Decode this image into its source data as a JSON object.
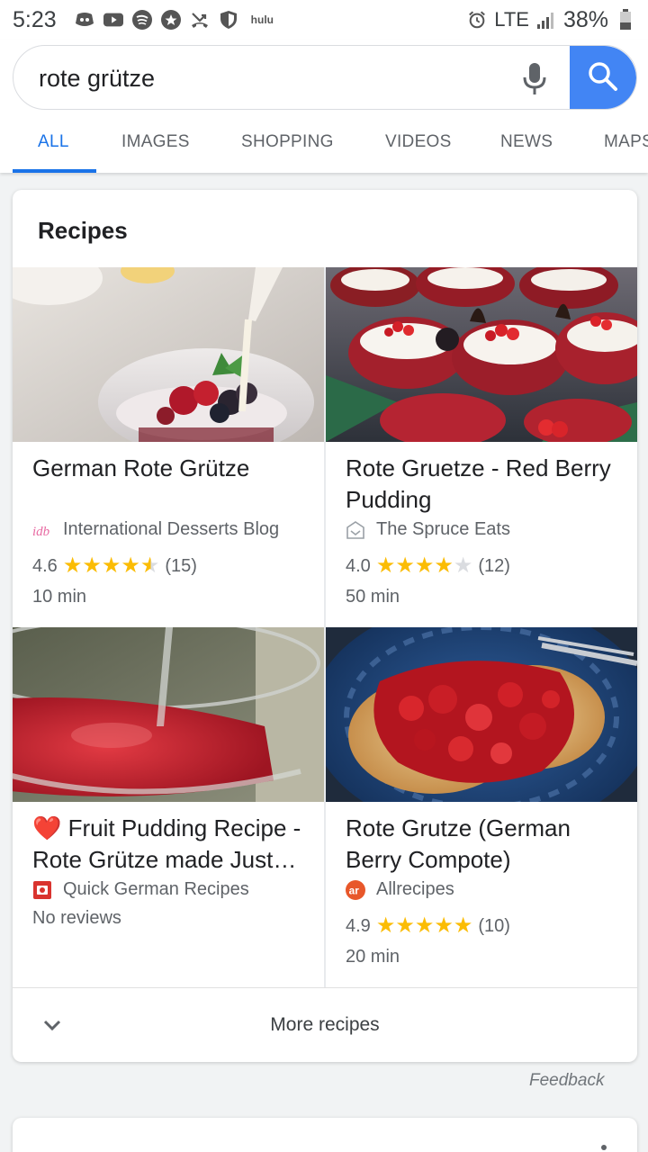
{
  "status": {
    "time": "5:23",
    "hulu": "hulu",
    "network": "LTE",
    "battery": "38%",
    "icons": [
      "discord-icon",
      "youtube-icon",
      "spotify-icon",
      "app-icon",
      "missed-call-icon",
      "shield-icon",
      "hulu-icon",
      "alarm-icon",
      "signal-icon",
      "battery-icon"
    ]
  },
  "search": {
    "query": "rote grütze",
    "button_icon": "search-icon"
  },
  "tabs": [
    {
      "label": "ALL",
      "active": true
    },
    {
      "label": "IMAGES",
      "active": false
    },
    {
      "label": "SHOPPING",
      "active": false
    },
    {
      "label": "VIDEOS",
      "active": false
    },
    {
      "label": "NEWS",
      "active": false
    },
    {
      "label": "MAPS",
      "active": false
    }
  ],
  "recipes_card": {
    "title": "Recipes",
    "items": [
      {
        "title": "German Rote Grütze",
        "source": "International Desserts Blog",
        "source_icon_text": "idb",
        "rating": "4.6",
        "rating_value": 4.6,
        "reviews": "(15)",
        "time": "10 min"
      },
      {
        "title": "Rote Gruetze - Red Berry Pudding",
        "source": "The Spruce Eats",
        "rating": "4.0",
        "rating_value": 4.0,
        "reviews": "(12)",
        "time": "50 min"
      },
      {
        "title_emoji": "❤️",
        "title": "Fruit Pudding Recipe - Rote Grütze made Just Like Oma's",
        "source": "Quick German Recipes",
        "no_reviews": "No reviews"
      },
      {
        "title": "Rote Grutze (German Berry Compote)",
        "source": "Allrecipes",
        "source_icon_text": "ar",
        "rating": "4.9",
        "rating_value": 4.9,
        "reviews": "(10)",
        "time": "20 min"
      }
    ],
    "more_label": "More recipes"
  },
  "feedback": "Feedback",
  "colors": {
    "accent": "#1a73e8",
    "search_button": "#4285f4",
    "star": "#fbbc04",
    "heart": "#e53935",
    "allrecipes": "#e8572a"
  }
}
